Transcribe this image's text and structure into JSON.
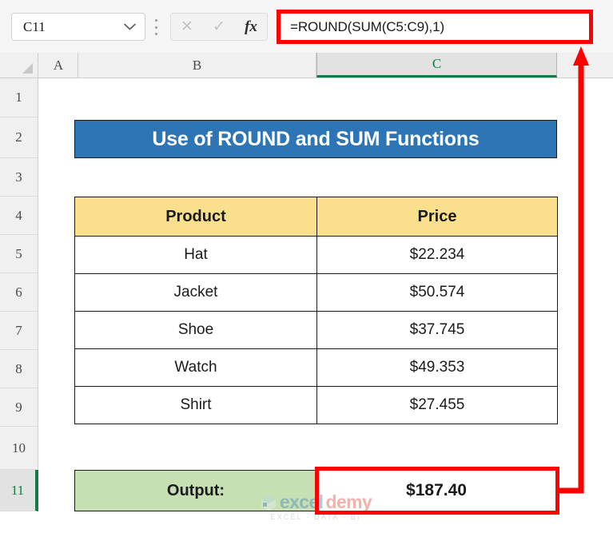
{
  "formula_bar": {
    "name_box_value": "C11",
    "cancel_icon": "close-icon",
    "confirm_icon": "check-icon",
    "function_icon": "fx-icon",
    "formula_value": "=ROUND(SUM(C5:C9),1)"
  },
  "grid": {
    "columns": [
      "A",
      "B",
      "C"
    ],
    "selected_column": "C",
    "rows": [
      "1",
      "2",
      "3",
      "4",
      "5",
      "6",
      "7",
      "8",
      "9",
      "10",
      "11"
    ],
    "selected_row": "11"
  },
  "sheet": {
    "banner_title": "Use of ROUND and SUM Functions",
    "table": {
      "headers": [
        "Product",
        "Price"
      ],
      "rows": [
        [
          "Hat",
          "$22.234"
        ],
        [
          "Jacket",
          "$50.574"
        ],
        [
          "Shoe",
          "$37.745"
        ],
        [
          "Watch",
          "$49.353"
        ],
        [
          "Shirt",
          "$27.455"
        ]
      ]
    },
    "output": {
      "label": "Output:",
      "value": "$187.40"
    }
  },
  "watermark": {
    "name_part1": "excel",
    "name_part2": "demy",
    "tagline": "EXCEL · DATA · BI"
  },
  "colors": {
    "banner_blue": "#2e75b6",
    "header_tan": "#fae08c",
    "output_green": "#c6e0b4",
    "highlight_red": "#ff0000",
    "excel_green": "#107c41"
  }
}
